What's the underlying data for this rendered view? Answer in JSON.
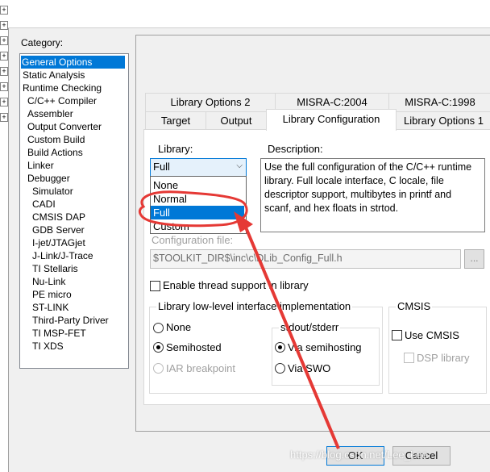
{
  "tree_expanders": [
    "+",
    "+",
    "+",
    "+",
    "+",
    "+",
    "+",
    "+"
  ],
  "category": {
    "label": "Category:",
    "items": [
      "General Options",
      "Static Analysis",
      "Runtime Checking",
      "C/C++ Compiler",
      "Assembler",
      "Output Converter",
      "Custom Build",
      "Build Actions",
      "Linker",
      "Debugger",
      "Simulator",
      "CADI",
      "CMSIS DAP",
      "GDB Server",
      "I-jet/JTAGjet",
      "J-Link/J-Trace",
      "TI Stellaris",
      "Nu-Link",
      "PE micro",
      "ST-LINK",
      "Third-Party Driver",
      "TI MSP-FET",
      "TI XDS"
    ],
    "selected": "General Options"
  },
  "tabs_row1": [
    "Library Options 2",
    "MISRA-C:2004",
    "MISRA-C:1998"
  ],
  "tabs_row2": [
    "Target",
    "Output",
    "Library Configuration",
    "Library Options 1"
  ],
  "active_tab": "Library Configuration",
  "library": {
    "label": "Library:",
    "value": "Full",
    "options": [
      "None",
      "Normal",
      "Full",
      "Custom"
    ],
    "selected": "Full"
  },
  "description": {
    "label": "Description:",
    "text": "Use the full configuration of the C/C++ runtime library. Full locale interface, C locale, file descriptor support, multibytes in printf and scanf, and hex floats in strtod."
  },
  "config_file": {
    "label": "Configuration file:",
    "value": "$TOOLKIT_DIR$\\inc\\c\\DLib_Config_Full.h",
    "browse": "..."
  },
  "thread_support": "Enable thread support in library",
  "lowlevel": {
    "title": "Library low-level interface implementation",
    "options": [
      "None",
      "Semihosted",
      "IAR breakpoint"
    ],
    "selected": "Semihosted"
  },
  "stdout": {
    "title": "stdout/stderr",
    "options": [
      "Via semihosting",
      "Via SWO"
    ],
    "selected": "Via semihosting"
  },
  "cmsis": {
    "title": "CMSIS",
    "use": "Use CMSIS",
    "dsp": "DSP library"
  },
  "buttons": {
    "ok": "OK",
    "cancel": "Cancel"
  },
  "watermark": "https://blog.csdn.net/Lee_Lee",
  "colors": {
    "selection": "#0078d7",
    "annotation": "#e53935"
  }
}
